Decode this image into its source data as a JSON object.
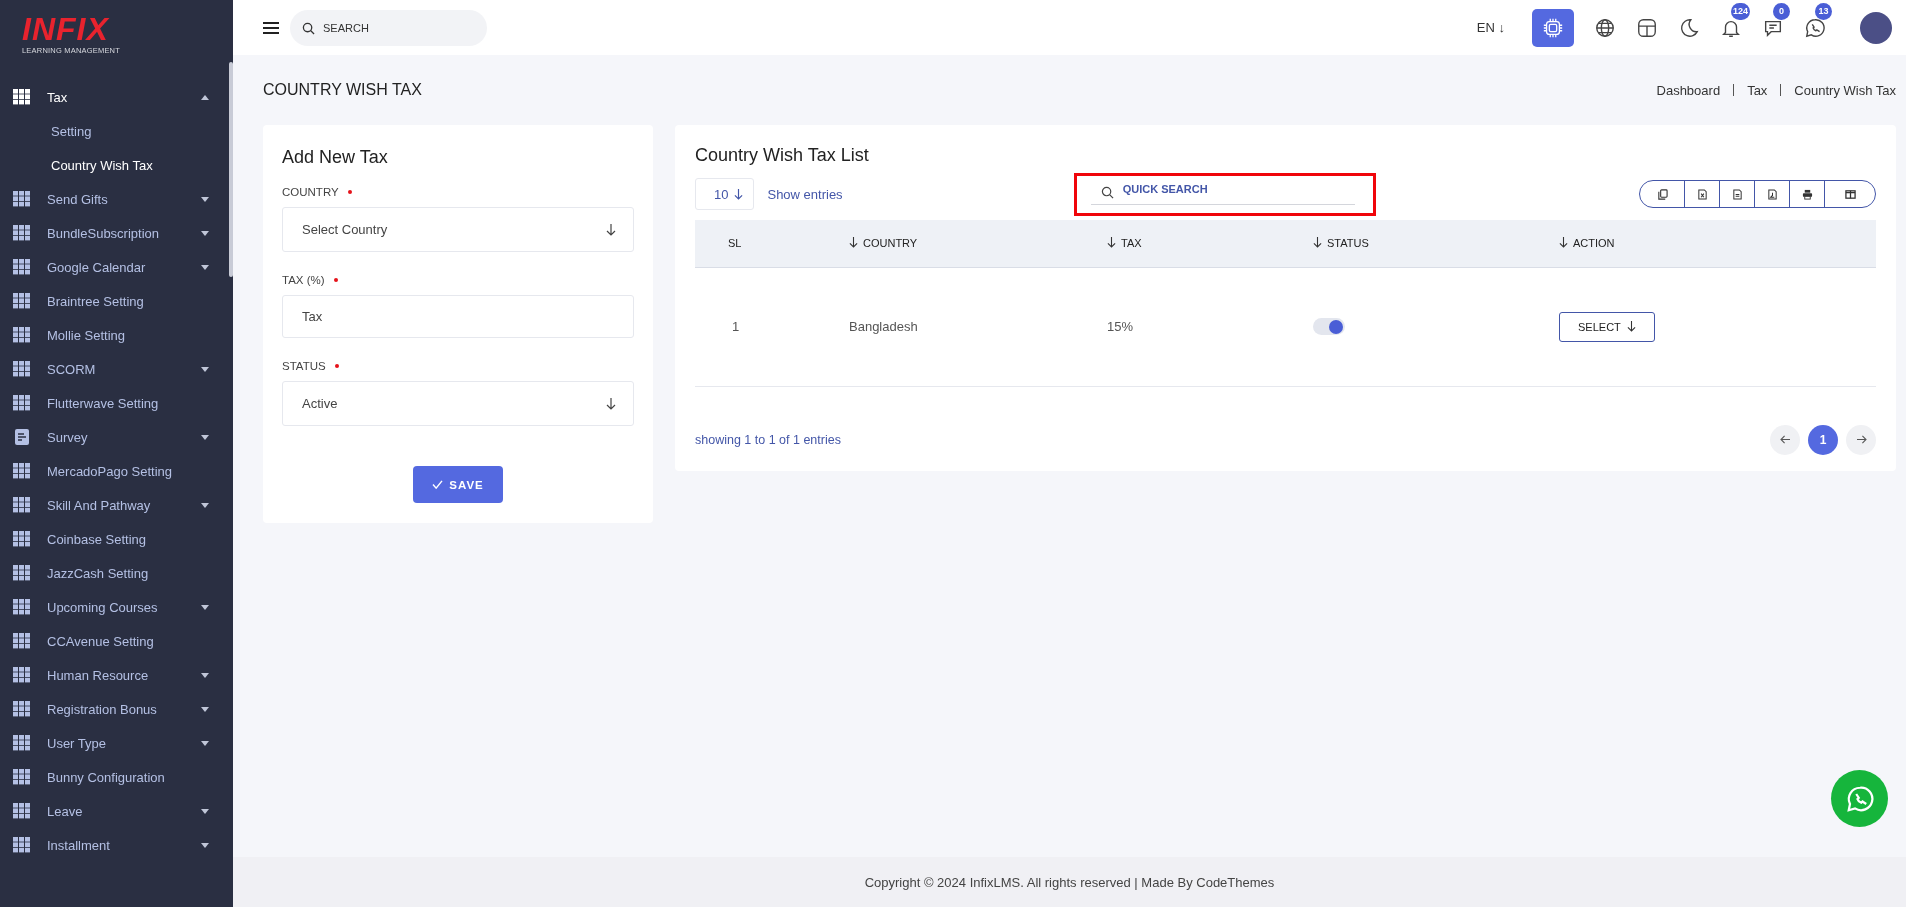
{
  "brand": {
    "logo": "INFIX",
    "tagline": "LEARNING MANAGEMENT"
  },
  "sidebar": {
    "items": [
      {
        "label": "Tax",
        "kind": "grid",
        "submenu": true,
        "expanded": true,
        "children": [
          {
            "label": "Setting",
            "selected": false
          },
          {
            "label": "Country Wish Tax",
            "selected": true
          }
        ]
      },
      {
        "label": "Send Gifts",
        "kind": "grid",
        "submenu": true,
        "expanded": false
      },
      {
        "label": "BundleSubscription",
        "kind": "grid",
        "submenu": true,
        "expanded": false
      },
      {
        "label": "Google Calendar",
        "kind": "grid",
        "submenu": true,
        "expanded": false
      },
      {
        "label": "Braintree Setting",
        "kind": "grid",
        "submenu": false,
        "expanded": false
      },
      {
        "label": "Mollie Setting",
        "kind": "grid",
        "submenu": false,
        "expanded": false
      },
      {
        "label": "SCORM",
        "kind": "grid",
        "submenu": true,
        "expanded": false
      },
      {
        "label": "Flutterwave Setting",
        "kind": "grid",
        "submenu": false,
        "expanded": false
      },
      {
        "label": "Survey",
        "kind": "survey",
        "submenu": true,
        "expanded": false
      },
      {
        "label": "MercadoPago Setting",
        "kind": "grid",
        "submenu": false,
        "expanded": false
      },
      {
        "label": "Skill And Pathway",
        "kind": "grid",
        "submenu": true,
        "expanded": false
      },
      {
        "label": "Coinbase Setting",
        "kind": "grid",
        "submenu": false,
        "expanded": false
      },
      {
        "label": "JazzCash Setting",
        "kind": "grid",
        "submenu": false,
        "expanded": false
      },
      {
        "label": "Upcoming Courses",
        "kind": "grid",
        "submenu": true,
        "expanded": false
      },
      {
        "label": "CCAvenue Setting",
        "kind": "grid",
        "submenu": false,
        "expanded": false
      },
      {
        "label": "Human Resource",
        "kind": "grid",
        "submenu": true,
        "expanded": false
      },
      {
        "label": "Registration Bonus",
        "kind": "grid",
        "submenu": true,
        "expanded": false
      },
      {
        "label": "User Type",
        "kind": "grid",
        "submenu": true,
        "expanded": false
      },
      {
        "label": "Bunny Configuration",
        "kind": "grid",
        "submenu": false,
        "expanded": false
      },
      {
        "label": "Leave",
        "kind": "grid",
        "submenu": true,
        "expanded": false
      },
      {
        "label": "Installment",
        "kind": "grid",
        "submenu": true,
        "expanded": false
      }
    ]
  },
  "topbar": {
    "search": {
      "placeholder": "SEARCH"
    },
    "language": "EN ↓",
    "icons": [
      {
        "kind": "ai"
      },
      {
        "kind": "globe"
      },
      {
        "kind": "layout"
      },
      {
        "kind": "moon"
      },
      {
        "kind": "bell",
        "badge": "124"
      },
      {
        "kind": "chat",
        "badge": "0"
      },
      {
        "kind": "phone",
        "badge": "13"
      }
    ]
  },
  "page": {
    "title": "COUNTRY WISH TAX",
    "breadcrumbs": [
      "Dashboard",
      "Tax",
      "Country Wish Tax"
    ]
  },
  "form": {
    "title": "Add New Tax",
    "fields": [
      {
        "label": "COUNTRY",
        "required": true,
        "kind": "select",
        "placeholder": "Select Country"
      },
      {
        "label": "TAX (%)",
        "required": true,
        "kind": "input",
        "placeholder": "Tax"
      },
      {
        "label": "STATUS",
        "required": true,
        "kind": "select",
        "value": "Active"
      }
    ],
    "save": "SAVE"
  },
  "list": {
    "title": "Country Wish Tax List",
    "page_size": "10",
    "show_entries": "Show entries",
    "quick_search": {
      "placeholder": "QUICK SEARCH",
      "highlighted": true
    },
    "export_buttons": [
      {
        "kind": "copy"
      },
      {
        "kind": "excel"
      },
      {
        "kind": "csv"
      },
      {
        "kind": "pdf"
      },
      {
        "kind": "print"
      },
      {
        "kind": "columns"
      }
    ],
    "columns": [
      {
        "label": "SL",
        "sortable": false
      },
      {
        "label": "COUNTRY",
        "sortable": true
      },
      {
        "label": "TAX",
        "sortable": true
      },
      {
        "label": "STATUS",
        "sortable": true
      },
      {
        "label": "ACTION",
        "sortable": true
      }
    ],
    "rows": [
      {
        "sl": "1",
        "country": "Bangladesh",
        "tax": "15%",
        "status_on": true,
        "action": "SELECT"
      }
    ],
    "info": "showing 1 to 1 of 1 entries",
    "pages": [
      {
        "label": "1",
        "selected": true
      }
    ]
  },
  "footer": "Copyright © 2024 InfixLMS. All rights reserved | Made By CodeThemes"
}
